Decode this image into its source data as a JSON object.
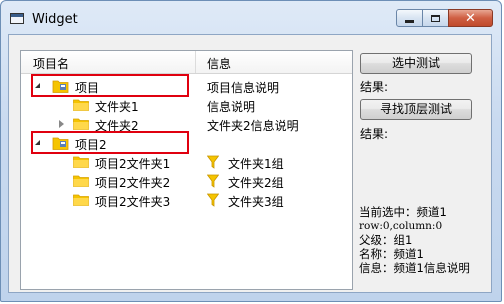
{
  "window": {
    "title": "Widget"
  },
  "caption": {
    "minimize": "min",
    "maximize": "max",
    "close": "✕"
  },
  "tree": {
    "headers": [
      "项目名",
      "信息"
    ],
    "rows": [
      {
        "name": "项目",
        "info": "项目信息说明",
        "level": 0,
        "expanded": true,
        "icon": "project-icon"
      },
      {
        "name": "文件夹1",
        "info": "信息说明",
        "level": 1,
        "expanded": null,
        "icon": "folder-icon"
      },
      {
        "name": "文件夹2",
        "info": "文件夹2信息说明",
        "level": 1,
        "expanded": false,
        "icon": "folder-icon"
      },
      {
        "name": "项目2",
        "info": "",
        "level": 0,
        "expanded": true,
        "icon": "project-icon"
      },
      {
        "name": "项目2文件夹1",
        "info": "文件夹1组",
        "level": 1,
        "expanded": null,
        "icon": "folder-icon",
        "info_icon": "filter-icon"
      },
      {
        "name": "项目2文件夹2",
        "info": "文件夹2组",
        "level": 1,
        "expanded": null,
        "icon": "folder-icon",
        "info_icon": "filter-icon"
      },
      {
        "name": "项目2文件夹3",
        "info": "文件夹3组",
        "level": 1,
        "expanded": null,
        "icon": "folder-icon",
        "info_icon": "filter-icon"
      }
    ]
  },
  "panel": {
    "select_test_button": "选中测试",
    "result1_label": "结果:",
    "find_top_button": "寻找顶层测试",
    "result2_label": "结果:",
    "current_selected": "当前选中：频道1",
    "row_col": "row:0,column:0",
    "parent": "父级：组1",
    "name": "名称：频道1",
    "info": "信息：频道1信息说明"
  },
  "colors": {
    "highlight": "#e0000f",
    "folder": "#f5c400",
    "accent": "#3a5d8a"
  }
}
